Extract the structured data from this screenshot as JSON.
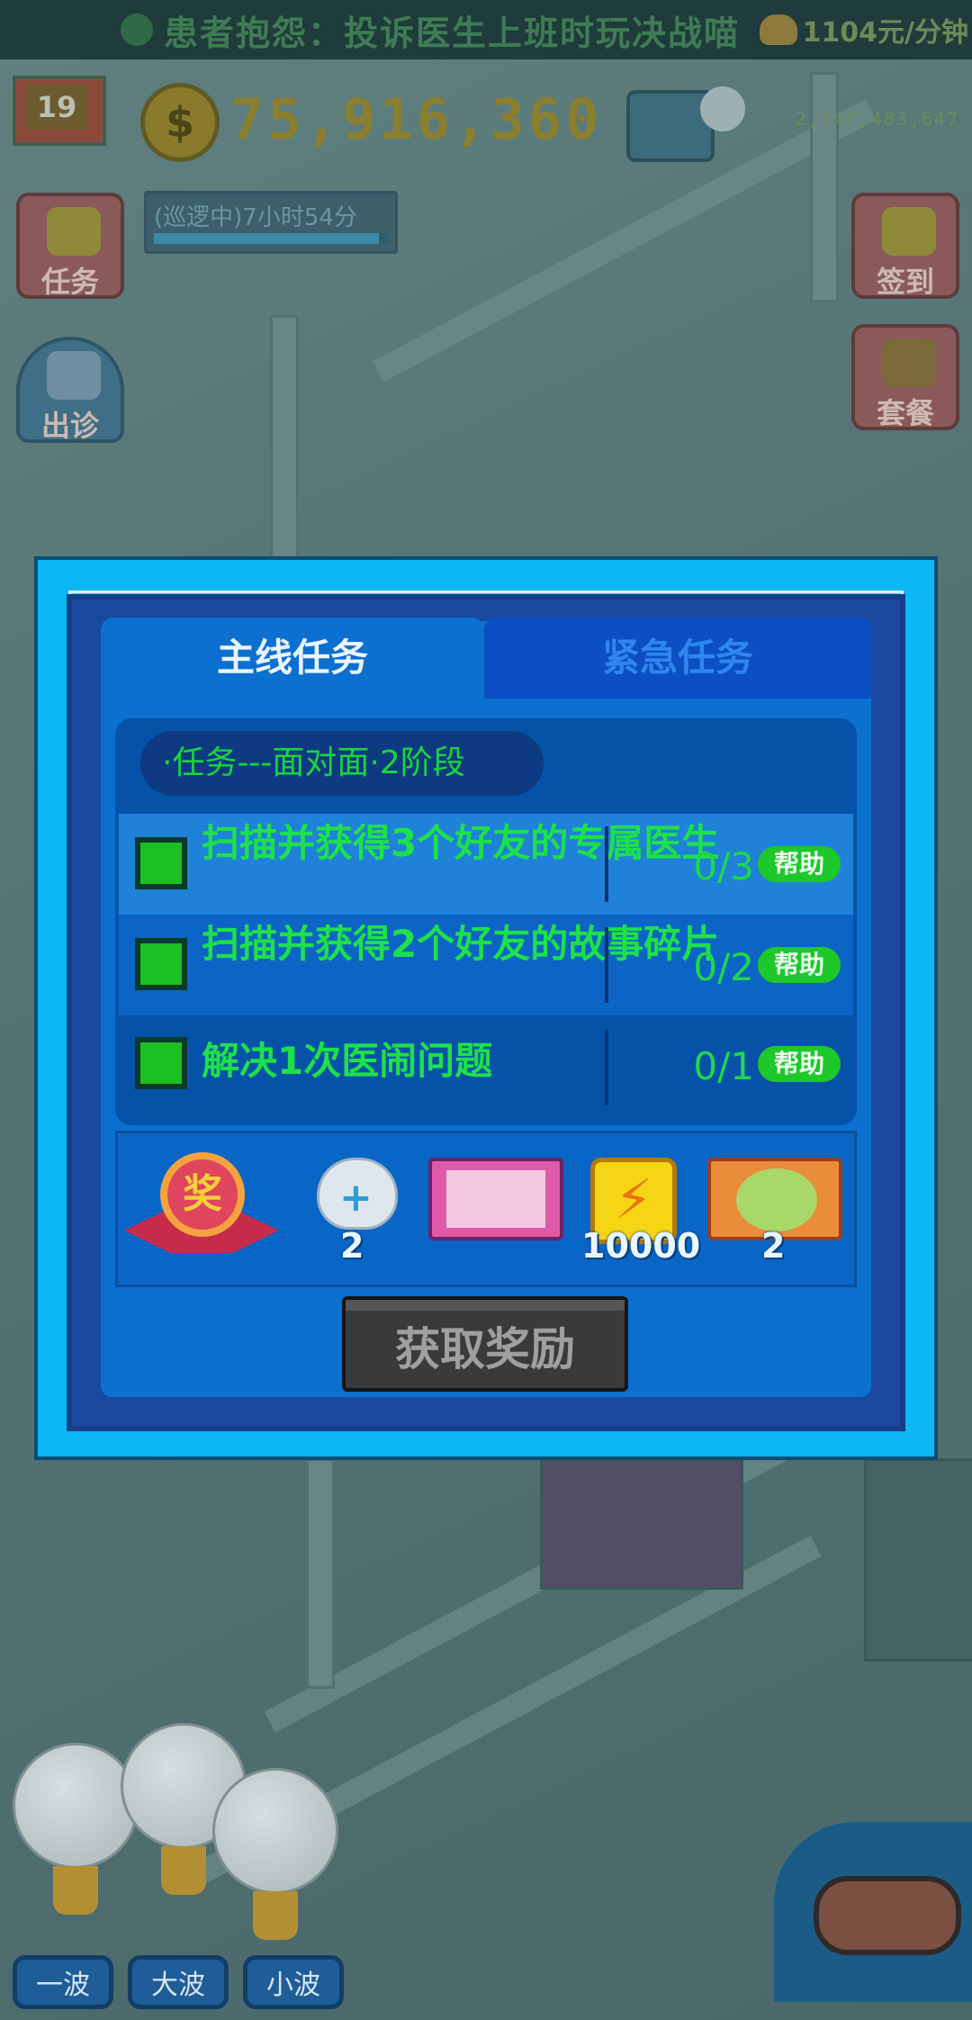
{
  "ticker": {
    "message": "患者抱怨：投诉医生上班时玩决战喵",
    "rate": "1104元/分钟"
  },
  "hud": {
    "level": "19",
    "coin_symbol": "$",
    "money": "75,916,360",
    "gems": "2,147,483,647",
    "patrol_status": "(巡逻中)7小时54分",
    "patrol_progress": 0.96,
    "tasks_label": "任务",
    "dispatch_label": "出诊",
    "signin_label": "签到",
    "package_label": "套餐"
  },
  "modal": {
    "tabs": [
      {
        "label": "主线任务",
        "active": true
      },
      {
        "label": "紧急任务",
        "active": false
      }
    ],
    "stage_title": "·任务---面对面·2阶段",
    "tasks": [
      {
        "text": "扫描并获得3个好友的专属医生",
        "progress": "0/3",
        "help": "帮助"
      },
      {
        "text": "扫描并获得2个好友的故事碎片",
        "progress": "0/2",
        "help": "帮助"
      },
      {
        "text": "解决1次医闹问题",
        "progress": "0/1",
        "help": "帮助"
      }
    ],
    "reward_medal": "奖",
    "rewards": [
      {
        "icon": "heal-cat-icon",
        "count": "2"
      },
      {
        "icon": "doctor-card-icon",
        "count": ""
      },
      {
        "icon": "energy-icon",
        "count": "10000"
      },
      {
        "icon": "character-ticket-icon",
        "count": "2"
      }
    ],
    "claim_label": "获取奖励"
  },
  "bottom": {
    "waves": [
      "一波",
      "大波",
      "小波"
    ]
  }
}
